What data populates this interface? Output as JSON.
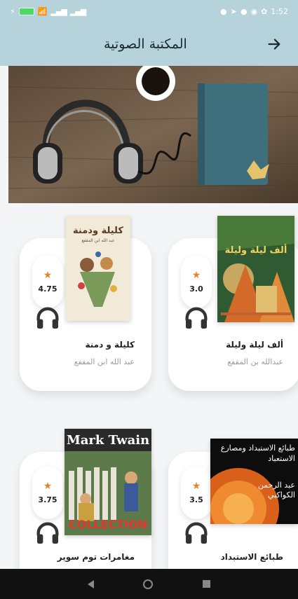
{
  "status": {
    "time": "1:52"
  },
  "app_bar": {
    "title": "المكتبة الصوتية"
  },
  "books": [
    {
      "title": "كليلة و دمنة",
      "author": "عبد الله ابن المقفع",
      "rating": "4.75",
      "cover_title": "كليلة ودمنة",
      "cover_subtitle": "عبد الله ابن المقفع"
    },
    {
      "title": "ألف ليلة وليلة",
      "author": "عبدالله بن المقفع",
      "rating": "3.0",
      "cover_title": "ألف ليلة وليلة"
    },
    {
      "title": "مغامرات توم سوير",
      "author": "",
      "rating": "3.75",
      "cover_title": "Mark Twain",
      "cover_subtitle": "COLLECTION"
    },
    {
      "title": "طبائع الاستبداد",
      "author": "",
      "rating": "3.5",
      "cover_title": "طبائع الاستبداد ومصارع الاستعباد",
      "cover_subtitle": "عبد الرحمن الكواكبي"
    }
  ],
  "colors": {
    "app_bar": "#b6d3dc",
    "star": "#e4832c",
    "nav": "#111111"
  }
}
